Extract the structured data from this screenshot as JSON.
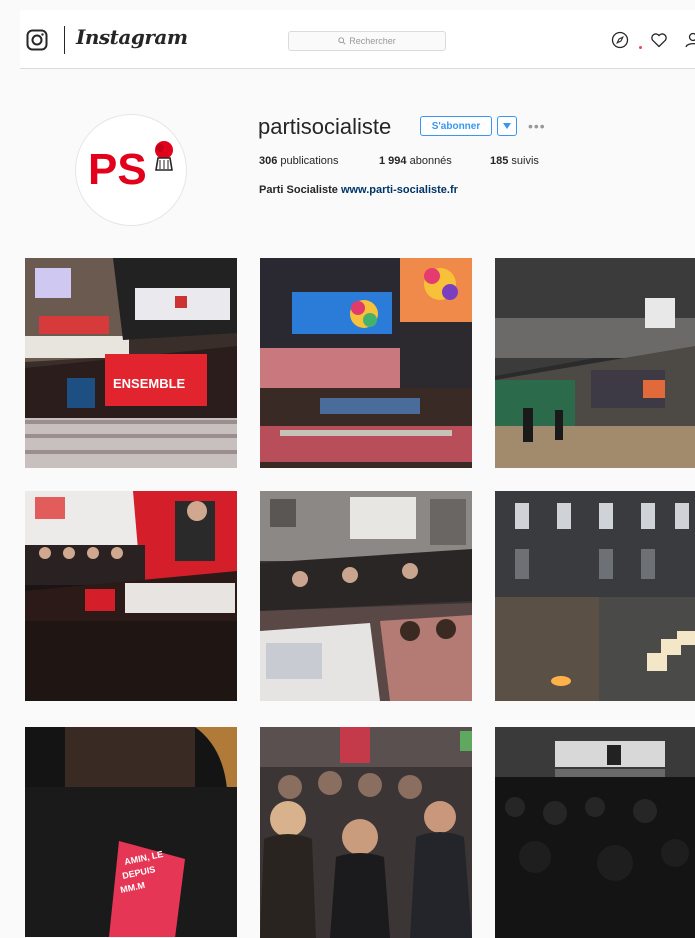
{
  "header": {
    "wordmark": "Instagram",
    "search_placeholder": "Rechercher",
    "icons": [
      "camera-icon",
      "search-icon",
      "compass-icon",
      "heart-icon",
      "person-icon"
    ]
  },
  "profile": {
    "username": "partisocialiste",
    "follow_label": "S'abonner",
    "posts_count": "306",
    "posts_label": "publications",
    "followers_count": "1 994",
    "followers_label": "abonnés",
    "following_count": "185",
    "following_label": "suivis",
    "full_name": "Parti Socialiste",
    "website": "www.parti-socialiste.fr",
    "logo_text": "PS"
  },
  "posts": [
    {
      "sign_text": "ENSEMBLE"
    },
    {},
    {},
    {},
    {},
    {},
    {},
    {},
    {
      "badge_lines": [
        "AMIN, LE",
        "DEPUIS",
        "MM.M"
      ]
    }
  ],
  "colors": {
    "accent": "#3897f0",
    "ps_red": "#e2001a",
    "background": "#fafafa",
    "border": "#dbdbdb"
  }
}
